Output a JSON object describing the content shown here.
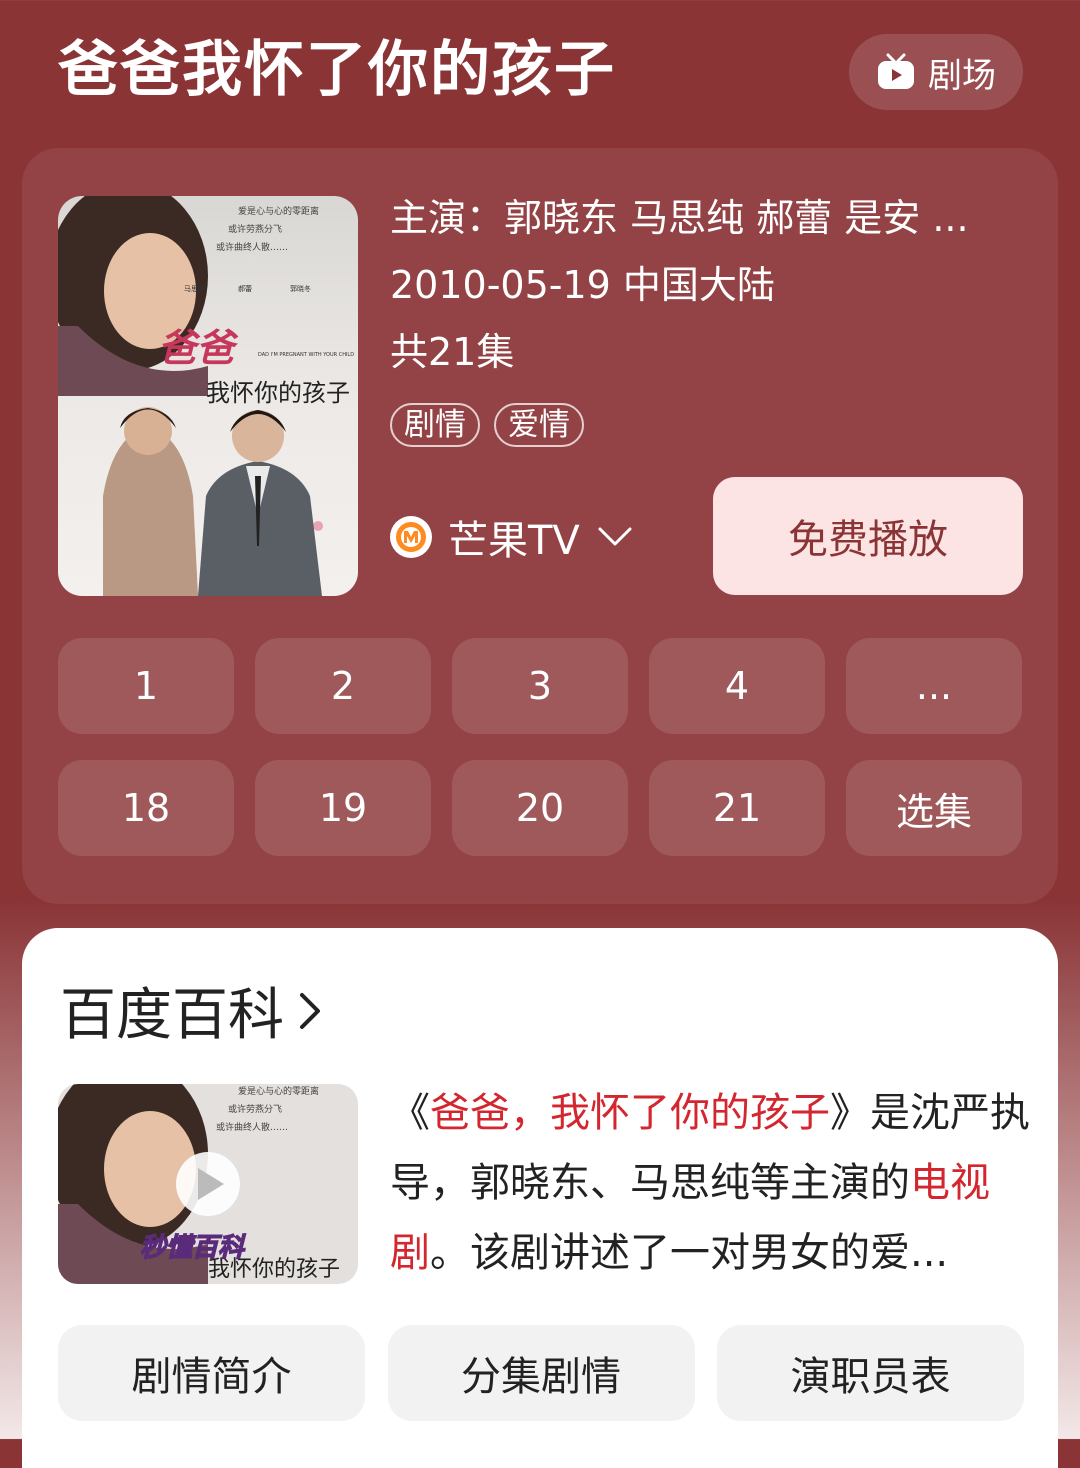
{
  "header": {
    "title": "爸爸我怀了你的孩子",
    "theater_label": "剧场",
    "theater_icon": "tv-icon"
  },
  "show": {
    "cast": "主演：郭晓东 马思纯 郝蕾 是安 ...",
    "date_region": "2010-05-19 中国大陆",
    "episodes_total": "共21集",
    "tags": [
      "剧情",
      "爱情"
    ],
    "source_name": "芒果TV",
    "play_label": "免费播放",
    "poster": {
      "top_lines": [
        "爱是心与心的零距离",
        "或许劳燕分飞",
        "或许曲终人散……"
      ],
      "actor_names": [
        "马思纯",
        "郝蕾",
        "郭晓冬"
      ],
      "title_big": "爸爸",
      "title_line": "我怀你的孩子",
      "en_title": "DAD I'M PREGNANT WITH YOUR CHILD"
    }
  },
  "episodes": {
    "row1": [
      "1",
      "2",
      "3",
      "4",
      "..."
    ],
    "row2": [
      "18",
      "19",
      "20",
      "21",
      "选集"
    ]
  },
  "baike": {
    "heading": "百度百科",
    "desc_open": "《",
    "desc_title": "爸爸，我怀了你的孩子",
    "desc_mid": "》是沈严执导，郭晓东、马思纯等主演的",
    "desc_link": "电视剧",
    "desc_end": "。该剧讲述了一对男女的爱...",
    "watermark": "秒懂百科",
    "tabs": [
      "剧情简介",
      "分集剧情",
      "演职员表"
    ]
  },
  "colors": {
    "background": "#8a3436",
    "play_button_bg": "#fde4e4",
    "link_red": "#d3262e"
  }
}
